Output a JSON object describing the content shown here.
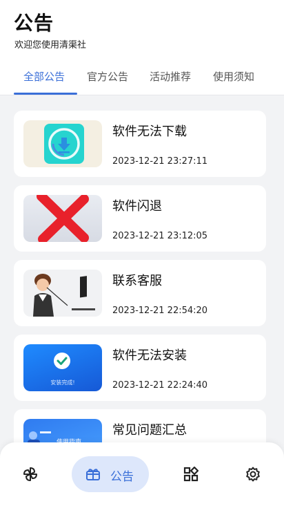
{
  "header": {
    "title": "公告",
    "subtitle": "欢迎您使用清渠社"
  },
  "tabs": [
    {
      "label": "全部公告",
      "active": true
    },
    {
      "label": "官方公告",
      "active": false
    },
    {
      "label": "活动推荐",
      "active": false
    },
    {
      "label": "使用须知",
      "active": false
    }
  ],
  "announcements": [
    {
      "title": "软件无法下载",
      "time": "2023-12-21 23:27:11",
      "thumb_icon": "download-icon"
    },
    {
      "title": "软件闪退",
      "time": "2023-12-21 23:12:05",
      "thumb_icon": "red-x-icon"
    },
    {
      "title": "联系客服",
      "time": "2023-12-21 22:54:20",
      "thumb_icon": "customer-service-illustration"
    },
    {
      "title": "软件无法安装",
      "time": "2023-12-21 22:24:40",
      "thumb_icon": "check-icon",
      "thumb_text": "安装完成!"
    },
    {
      "title": "常见问题汇总",
      "time": "",
      "thumb_icon": "guide-illustration",
      "thumb_text": "使用指南"
    }
  ],
  "bottom_nav": [
    {
      "name": "home",
      "icon": "pinwheel-icon"
    },
    {
      "name": "announcements",
      "icon": "gift-box-icon",
      "label": "公告",
      "active": true
    },
    {
      "name": "apps",
      "icon": "grid-icon"
    },
    {
      "name": "settings",
      "icon": "gear-icon"
    }
  ],
  "colors": {
    "accent": "#3a6fd8",
    "background": "#f2f3f5",
    "active_pill": "#dde7fb"
  }
}
